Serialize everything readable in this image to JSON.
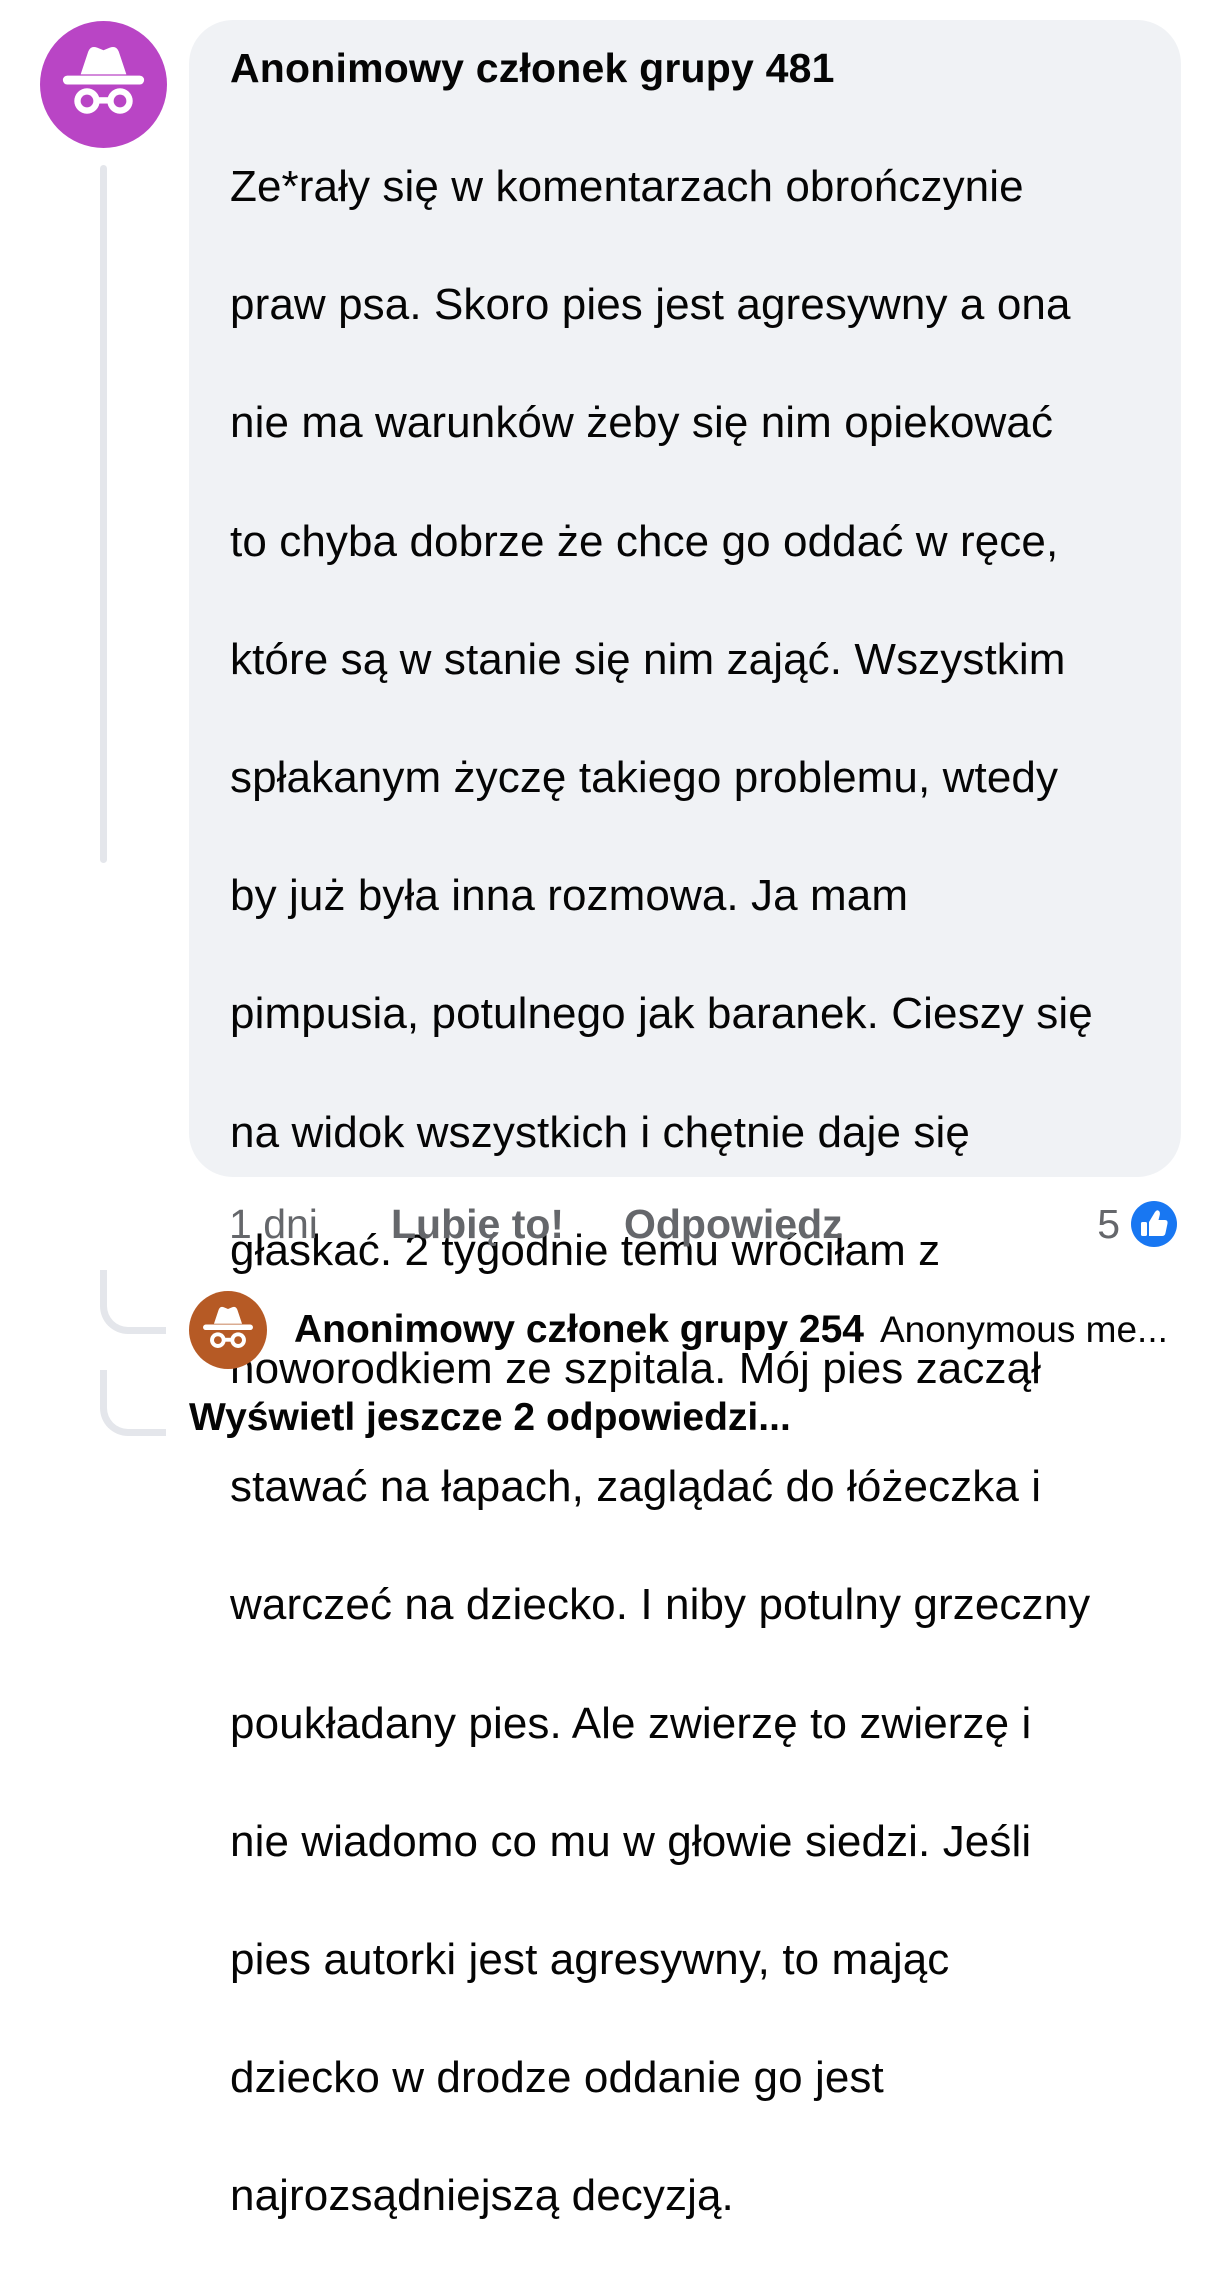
{
  "comment": {
    "author": "Anonimowy członek grupy 481",
    "avatar_icon": "incognito-hat-glasses-icon",
    "avatar_color": "#b945c5",
    "body_lines": [
      "Ze*rały się w komentarzach obrończynie",
      "praw psa. Skoro pies jest agresywny a ona",
      "nie ma warunków żeby się nim opiekować",
      "to chyba dobrze że chce go oddać w ręce,",
      "które są w stanie się nim zająć. Wszystkim",
      "spłakanym życzę takiego problemu, wtedy",
      "by już była inna rozmowa. Ja mam",
      "pimpusia, potulnego jak baranek. Cieszy się",
      "na widok wszystkich i chętnie daje się",
      "głaskać. 2 tygodnie temu wróciłam z",
      "noworodkiem ze szpitala. Mój pies zaczął",
      "stawać na łapach, zaglądać do łóżeczka i",
      "warczeć na dziecko. I niby potulny grzeczny",
      "poukładany pies. Ale zwierzę to zwierzę i",
      "nie wiadomo co mu w głowie siedzi. Jeśli",
      "pies autorki jest agresywny, to mając",
      "dziecko w drodze oddanie go jest",
      "najrozsądniejszą decyzją."
    ]
  },
  "actions": {
    "time": "1 dni",
    "like_label": "Lubię to!",
    "reply_label": "Odpowiedz",
    "reaction_count": "5",
    "reaction_icon": "thumbs-up-icon",
    "reaction_color": "#1877f2"
  },
  "reply": {
    "author": "Anonimowy członek grupy 254",
    "preview": "Anonymous me...",
    "avatar_icon": "incognito-hat-glasses-icon",
    "avatar_color": "#b65a25"
  },
  "more_replies_label": "Wyświetl jeszcze 2 odpowiedzi..."
}
